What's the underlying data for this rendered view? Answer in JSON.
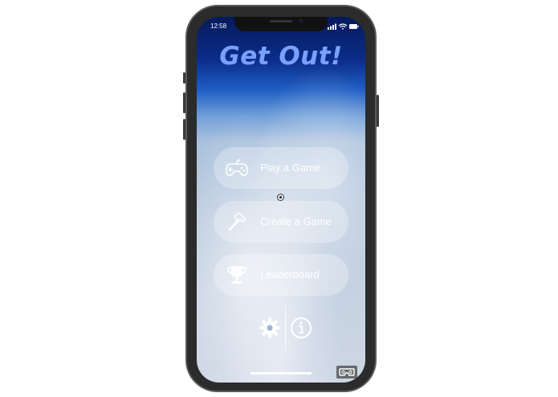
{
  "status_bar": {
    "time": "12:58"
  },
  "app": {
    "title": "Get Out!"
  },
  "menu": {
    "play_label": "Play a Game",
    "create_label": "Create a Game",
    "leaderboard_label": "Leaderboard"
  },
  "icons": {
    "play": "gamepad-icon",
    "create": "hammer-icon",
    "leaderboard": "trophy-icon",
    "settings": "gear-icon",
    "info": "info-icon",
    "vr": "vr-headset-icon"
  },
  "colors": {
    "title": "#7aa0ff",
    "sky_top": "#061a5c",
    "button_fill": "rgba(255,255,255,0.28)"
  }
}
